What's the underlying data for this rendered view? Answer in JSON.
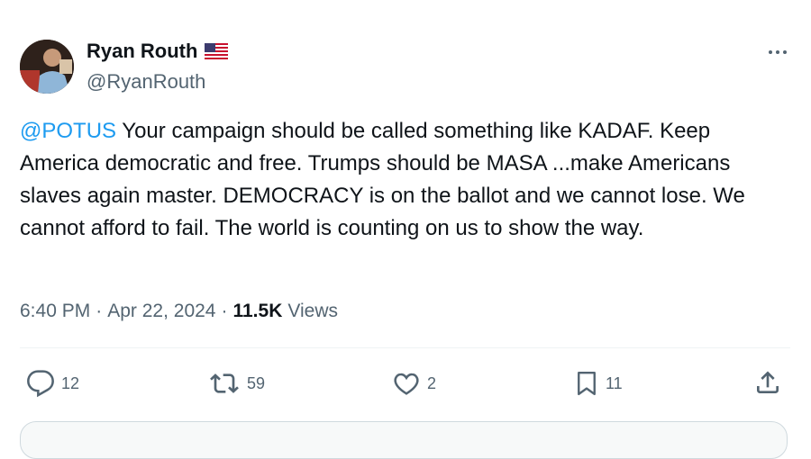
{
  "author": {
    "display_name": "Ryan Routh",
    "handle": "@RyanRouth",
    "verified_flag_icon": "us-flag-icon"
  },
  "tweet": {
    "mention": "@POTUS",
    "body": " Your campaign should be called something like KADAF. Keep America democratic and free. Trumps should be MASA ...make Americans slaves again master. DEMOCRACY is on the ballot and we cannot lose. We cannot afford to fail. The world is counting on us to show the way.",
    "time": "6:40 PM",
    "sep1": "·",
    "date": "Apr 22, 2024",
    "sep2": "·",
    "views_count": "11.5K",
    "views_label": "Views"
  },
  "actions": {
    "replies": "12",
    "reposts": "59",
    "likes": "2",
    "bookmarks": "11"
  },
  "icons": [
    "more-icon",
    "reply-icon",
    "repost-icon",
    "like-icon",
    "bookmark-icon",
    "share-icon"
  ],
  "colors": {
    "link": "#1d9bf0",
    "secondary_text": "#536471",
    "primary_text": "#0f1419"
  }
}
